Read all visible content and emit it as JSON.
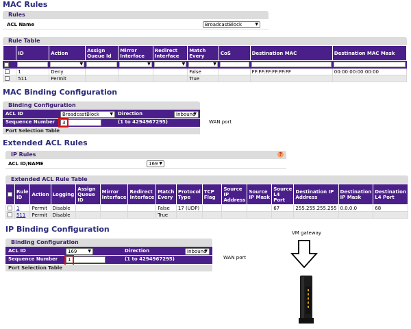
{
  "mac_rules": {
    "title": "MAC Rules",
    "rules_panel": {
      "header": "Rules",
      "acl_name_label": "ACL Name",
      "acl_name_value": "BroadcastBlock"
    },
    "rule_table": {
      "header": "Rule Table",
      "columns": [
        "ID",
        "Action",
        "Assign Queue Id",
        "Mirror Interface",
        "Redirect Interface",
        "Match Every",
        "CoS",
        "Destination MAC",
        "Destination MAC Mask"
      ],
      "rows": [
        {
          "id": "1",
          "action": "Deny",
          "queue": "",
          "mirror": "",
          "redirect": "",
          "match": "False",
          "cos": "",
          "dest_mac": "FF:FF:FF:FF:FF:FF",
          "dest_mask": "00:00:00:00:00:00"
        },
        {
          "id": "511",
          "action": "Permit",
          "queue": "",
          "mirror": "",
          "redirect": "",
          "match": "True",
          "cos": "",
          "dest_mac": "",
          "dest_mask": ""
        }
      ]
    }
  },
  "mac_binding": {
    "title": "MAC Binding Configuration",
    "header": "Binding Configuration",
    "acl_id_label": "ACL ID",
    "acl_id_value": "BroadcastBlock",
    "direction_label": "Direction",
    "direction_value": "Inbound",
    "seq_label": "Sequence Number",
    "seq_value": "3",
    "seq_range": "(1 to 4294967295)",
    "footer": "Port Selection Table",
    "annotation": "WAN port"
  },
  "extended_acl": {
    "title": "Extended ACL Rules",
    "ip_rules_panel": {
      "header": "IP Rules",
      "acl_label": "ACL ID/NAME",
      "acl_value": "169"
    },
    "rule_table": {
      "header": "Extended ACL Rule Table",
      "columns": [
        "Rule ID",
        "Action",
        "Logging",
        "Assign Queue ID",
        "Mirror Interface",
        "Redirect Interface",
        "Match Every",
        "Protocol Type",
        "TCP Flag",
        "Source IP Address",
        "Source IP Mask",
        "Source L4 Port",
        "Destination IP Address",
        "Destination IP Mask",
        "Destination L4 Port"
      ],
      "rows": [
        {
          "id": "1",
          "action": "Permit",
          "logging": "Disable",
          "queue": "",
          "mirror": "",
          "redirect": "",
          "match": "False",
          "protocol": "17 (UDP)",
          "tcp": "",
          "src_ip": "",
          "src_mask": "",
          "src_port": "67",
          "dst_ip": "255.255.255.255",
          "dst_mask": "0.0.0.0",
          "dst_port": "68"
        },
        {
          "id": "511",
          "action": "Permit",
          "logging": "Disable",
          "queue": "",
          "mirror": "",
          "redirect": "",
          "match": "True",
          "protocol": "",
          "tcp": "",
          "src_ip": "",
          "src_mask": "",
          "src_port": "",
          "dst_ip": "",
          "dst_mask": "",
          "dst_port": ""
        }
      ]
    }
  },
  "ip_binding": {
    "title": "IP Binding Configuration",
    "header": "Binding Configuration",
    "acl_id_label": "ACL ID",
    "acl_id_value": "169",
    "direction_label": "Direction",
    "direction_value": "Inbound",
    "seq_label": "Sequence Number",
    "seq_value": "1",
    "seq_range": "(1 to 4294967295)",
    "footer": "Port Selection Table",
    "annotation": "WAN port"
  },
  "diagram": {
    "gateway_label": "VM gateway"
  },
  "colors": {
    "header_purple": "#4a1f8a",
    "section_title": "#2a2a7a",
    "highlight_red": "#d0141a"
  }
}
